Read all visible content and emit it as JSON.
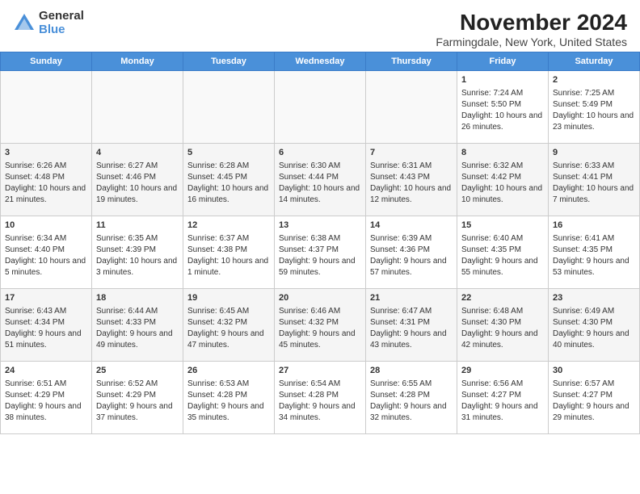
{
  "header": {
    "logo_line1": "General",
    "logo_line2": "Blue",
    "title": "November 2024",
    "subtitle": "Farmingdale, New York, United States"
  },
  "days_of_week": [
    "Sunday",
    "Monday",
    "Tuesday",
    "Wednesday",
    "Thursday",
    "Friday",
    "Saturday"
  ],
  "weeks": [
    [
      {
        "day": "",
        "content": ""
      },
      {
        "day": "",
        "content": ""
      },
      {
        "day": "",
        "content": ""
      },
      {
        "day": "",
        "content": ""
      },
      {
        "day": "",
        "content": ""
      },
      {
        "day": "1",
        "content": "Sunrise: 7:24 AM\nSunset: 5:50 PM\nDaylight: 10 hours and 26 minutes."
      },
      {
        "day": "2",
        "content": "Sunrise: 7:25 AM\nSunset: 5:49 PM\nDaylight: 10 hours and 23 minutes."
      }
    ],
    [
      {
        "day": "3",
        "content": "Sunrise: 6:26 AM\nSunset: 4:48 PM\nDaylight: 10 hours and 21 minutes."
      },
      {
        "day": "4",
        "content": "Sunrise: 6:27 AM\nSunset: 4:46 PM\nDaylight: 10 hours and 19 minutes."
      },
      {
        "day": "5",
        "content": "Sunrise: 6:28 AM\nSunset: 4:45 PM\nDaylight: 10 hours and 16 minutes."
      },
      {
        "day": "6",
        "content": "Sunrise: 6:30 AM\nSunset: 4:44 PM\nDaylight: 10 hours and 14 minutes."
      },
      {
        "day": "7",
        "content": "Sunrise: 6:31 AM\nSunset: 4:43 PM\nDaylight: 10 hours and 12 minutes."
      },
      {
        "day": "8",
        "content": "Sunrise: 6:32 AM\nSunset: 4:42 PM\nDaylight: 10 hours and 10 minutes."
      },
      {
        "day": "9",
        "content": "Sunrise: 6:33 AM\nSunset: 4:41 PM\nDaylight: 10 hours and 7 minutes."
      }
    ],
    [
      {
        "day": "10",
        "content": "Sunrise: 6:34 AM\nSunset: 4:40 PM\nDaylight: 10 hours and 5 minutes."
      },
      {
        "day": "11",
        "content": "Sunrise: 6:35 AM\nSunset: 4:39 PM\nDaylight: 10 hours and 3 minutes."
      },
      {
        "day": "12",
        "content": "Sunrise: 6:37 AM\nSunset: 4:38 PM\nDaylight: 10 hours and 1 minute."
      },
      {
        "day": "13",
        "content": "Sunrise: 6:38 AM\nSunset: 4:37 PM\nDaylight: 9 hours and 59 minutes."
      },
      {
        "day": "14",
        "content": "Sunrise: 6:39 AM\nSunset: 4:36 PM\nDaylight: 9 hours and 57 minutes."
      },
      {
        "day": "15",
        "content": "Sunrise: 6:40 AM\nSunset: 4:35 PM\nDaylight: 9 hours and 55 minutes."
      },
      {
        "day": "16",
        "content": "Sunrise: 6:41 AM\nSunset: 4:35 PM\nDaylight: 9 hours and 53 minutes."
      }
    ],
    [
      {
        "day": "17",
        "content": "Sunrise: 6:43 AM\nSunset: 4:34 PM\nDaylight: 9 hours and 51 minutes."
      },
      {
        "day": "18",
        "content": "Sunrise: 6:44 AM\nSunset: 4:33 PM\nDaylight: 9 hours and 49 minutes."
      },
      {
        "day": "19",
        "content": "Sunrise: 6:45 AM\nSunset: 4:32 PM\nDaylight: 9 hours and 47 minutes."
      },
      {
        "day": "20",
        "content": "Sunrise: 6:46 AM\nSunset: 4:32 PM\nDaylight: 9 hours and 45 minutes."
      },
      {
        "day": "21",
        "content": "Sunrise: 6:47 AM\nSunset: 4:31 PM\nDaylight: 9 hours and 43 minutes."
      },
      {
        "day": "22",
        "content": "Sunrise: 6:48 AM\nSunset: 4:30 PM\nDaylight: 9 hours and 42 minutes."
      },
      {
        "day": "23",
        "content": "Sunrise: 6:49 AM\nSunset: 4:30 PM\nDaylight: 9 hours and 40 minutes."
      }
    ],
    [
      {
        "day": "24",
        "content": "Sunrise: 6:51 AM\nSunset: 4:29 PM\nDaylight: 9 hours and 38 minutes."
      },
      {
        "day": "25",
        "content": "Sunrise: 6:52 AM\nSunset: 4:29 PM\nDaylight: 9 hours and 37 minutes."
      },
      {
        "day": "26",
        "content": "Sunrise: 6:53 AM\nSunset: 4:28 PM\nDaylight: 9 hours and 35 minutes."
      },
      {
        "day": "27",
        "content": "Sunrise: 6:54 AM\nSunset: 4:28 PM\nDaylight: 9 hours and 34 minutes."
      },
      {
        "day": "28",
        "content": "Sunrise: 6:55 AM\nSunset: 4:28 PM\nDaylight: 9 hours and 32 minutes."
      },
      {
        "day": "29",
        "content": "Sunrise: 6:56 AM\nSunset: 4:27 PM\nDaylight: 9 hours and 31 minutes."
      },
      {
        "day": "30",
        "content": "Sunrise: 6:57 AM\nSunset: 4:27 PM\nDaylight: 9 hours and 29 minutes."
      }
    ]
  ]
}
